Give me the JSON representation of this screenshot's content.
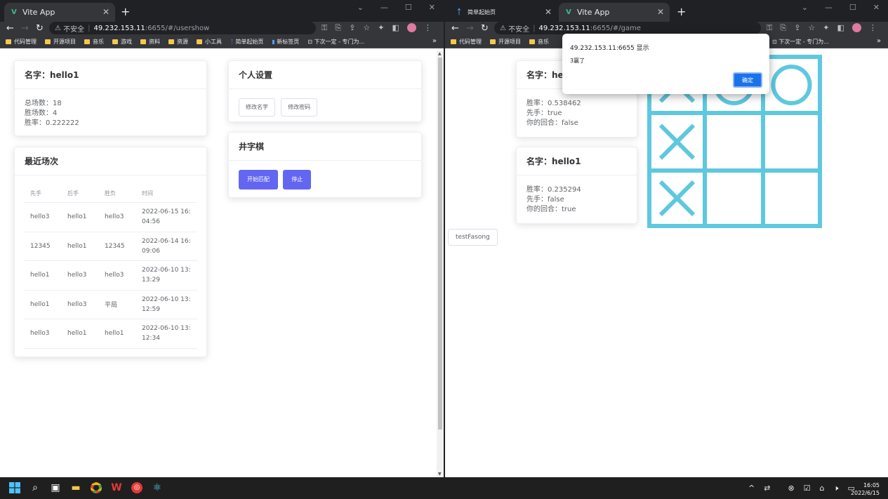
{
  "left": {
    "tab_title": "Vite App",
    "addr_insecure": "不安全",
    "addr_host": "49.232.153.11",
    "addr_path": ":6655/#/usershow",
    "bookmarks": [
      "代码管理",
      "开源项目",
      "音乐",
      "游戏",
      "资料",
      "资源",
      "小工具",
      "简单起始页",
      "新标签页",
      "下次一定 - 专门为..."
    ],
    "user_card": {
      "title": "名字：hello1",
      "lines": [
        "总场数：18",
        "胜场数：4",
        "胜率：0.222222"
      ]
    },
    "settings_card": {
      "title": "个人设置",
      "buttons": [
        "修改名字",
        "修改密码"
      ]
    },
    "game_card": {
      "title": "井字棋",
      "buttons": [
        "开始匹配",
        "停止"
      ]
    },
    "recent_card": {
      "title": "最近场次",
      "columns": [
        "先手",
        "后手",
        "胜负",
        "时间"
      ],
      "rows": [
        [
          "hello3",
          "hello1",
          "hello3",
          "2022-06-15 16:04:56"
        ],
        [
          "12345",
          "hello1",
          "12345",
          "2022-06-14 16:09:06"
        ],
        [
          "hello1",
          "hello3",
          "hello3",
          "2022-06-10 13:13:29"
        ],
        [
          "hello1",
          "hello3",
          "平局",
          "2022-06-10 13:12:59"
        ],
        [
          "hello3",
          "hello1",
          "hello1",
          "2022-06-10 13:12:34"
        ]
      ]
    }
  },
  "right": {
    "tabs": [
      "简单起始页",
      "Vite App"
    ],
    "addr_insecure": "不安全",
    "addr_host": "49.232.153.11",
    "addr_path": ":6655/#/game",
    "bookmarks": [
      "代码管理",
      "开源项目",
      "音乐"
    ],
    "bookmark_tail": "下次一定 - 专门为...",
    "opponent_card": {
      "title": "名字：hel",
      "lines": [
        "胜率：0.538462",
        "先手：true",
        "你的回合：false"
      ]
    },
    "self_card": {
      "title": "名字：hello1",
      "lines": [
        "胜率：0.235294",
        "先手：false",
        "你的回合：true"
      ]
    },
    "board": [
      "X",
      "O",
      "O",
      "X",
      "",
      "",
      "X",
      "",
      ""
    ],
    "test_button": "testFasong",
    "dialog": {
      "origin": "49.232.153.11:6655 显示",
      "message": "3赢了",
      "ok": "确定"
    }
  },
  "taskbar": {
    "time": "16:05",
    "date": "2022/6/15"
  },
  "colors": {
    "primary": "#6366f1",
    "board": "#5ec8df",
    "chrome_dark": "#202124",
    "dialog_ok": "#1a73e8"
  }
}
